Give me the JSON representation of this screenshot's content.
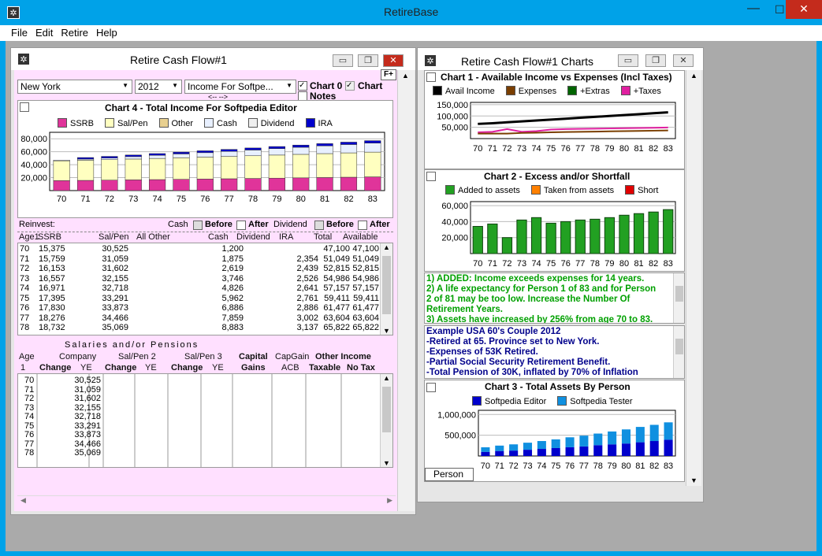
{
  "app": {
    "title": "RetireBase",
    "menu": [
      "File",
      "Edit",
      "Retire",
      "Help"
    ]
  },
  "cashflow": {
    "title": "Retire Cash Flow#1",
    "province": "New York",
    "year": "2012",
    "income_select": "Income For Softpe...",
    "chart0": "Chart 0",
    "chart": "Chart",
    "notes": "Notes",
    "arrows": "<--      -->",
    "fplus": "F+",
    "chart4": {
      "title": "Chart 4 - Total Income For Softpedia Editor",
      "legend": [
        {
          "name": "SSRB",
          "color": "#e0349a"
        },
        {
          "name": "Sal/Pen",
          "color": "#ffffc0"
        },
        {
          "name": "Other",
          "color": "#e8d090"
        },
        {
          "name": "Cash",
          "color": "#e8f0ff"
        },
        {
          "name": "Dividend",
          "color": "#f0f0f0"
        },
        {
          "name": "IRA",
          "color": "#0000cc"
        }
      ],
      "y_ticks": [
        "80,000",
        "60,000",
        "40,000",
        "20,000"
      ],
      "x": [
        "70",
        "71",
        "72",
        "73",
        "74",
        "75",
        "76",
        "77",
        "78",
        "79",
        "80",
        "81",
        "82",
        "83"
      ],
      "ssrb": [
        15375,
        15759,
        16153,
        16557,
        16971,
        17395,
        17830,
        18276,
        18732,
        19201,
        19681,
        20173,
        20677,
        21194
      ],
      "salpen": [
        30525,
        31059,
        31602,
        32155,
        32718,
        33291,
        33873,
        34466,
        35069,
        35683,
        36307,
        36943,
        37589,
        38247
      ],
      "cash": [
        1200,
        1875,
        2619,
        3746,
        4826,
        5962,
        6886,
        7859,
        8883,
        9900,
        10900,
        11900,
        12900,
        13900
      ],
      "ira": [
        0,
        2354,
        2439,
        2526,
        2641,
        2761,
        2886,
        3002,
        3137,
        3270,
        3400,
        3530,
        3660,
        3790
      ]
    },
    "reinvest": {
      "label": "Reinvest:",
      "cash": "Cash",
      "before": "Before",
      "after": "After",
      "dividend": "Dividend",
      "before2": "Before",
      "after2": "After"
    },
    "table_headers": [
      "Age1",
      "SSRB",
      "Sal/Pen",
      "All Other",
      "Cash",
      "Dividend",
      "IRA",
      "Total",
      "Available"
    ],
    "rows": [
      [
        "70",
        "15,375",
        "30,525",
        "",
        "1,200",
        "",
        "",
        "47,100",
        "47,100"
      ],
      [
        "71",
        "15,759",
        "31,059",
        "",
        "1,875",
        "",
        "2,354",
        "51,049",
        "51,049"
      ],
      [
        "72",
        "16,153",
        "31,602",
        "",
        "2,619",
        "",
        "2,439",
        "52,815",
        "52,815"
      ],
      [
        "73",
        "16,557",
        "32,155",
        "",
        "3,746",
        "",
        "2,526",
        "54,986",
        "54,986"
      ],
      [
        "74",
        "16,971",
        "32,718",
        "",
        "4,826",
        "",
        "2,641",
        "57,157",
        "57,157"
      ],
      [
        "75",
        "17,395",
        "33,291",
        "",
        "5,962",
        "",
        "2,761",
        "59,411",
        "59,411"
      ],
      [
        "76",
        "17,830",
        "33,873",
        "",
        "6,886",
        "",
        "2,886",
        "61,477",
        "61,477"
      ],
      [
        "77",
        "18,276",
        "34,466",
        "",
        "7,859",
        "",
        "3,002",
        "63,604",
        "63,604"
      ],
      [
        "78",
        "18,732",
        "35,069",
        "",
        "8,883",
        "",
        "3,137",
        "65,822",
        "65,822"
      ]
    ],
    "sal_title": "Salaries and/or Pensions",
    "sal_h1": [
      "Age",
      "Company",
      "Sal/Pen 2",
      "Sal/Pen 3",
      "Capital",
      "CapGain",
      "Other Income"
    ],
    "sal_h2": [
      "1",
      "Change",
      "YE",
      "Change",
      "YE",
      "Change",
      "YE",
      "Gains",
      "ACB",
      "Taxable",
      "No Tax"
    ],
    "sal_ages": [
      "70",
      "71",
      "72",
      "73",
      "74",
      "75",
      "76",
      "77",
      "78"
    ],
    "sal_ye": [
      "30,525",
      "31,059",
      "31,602",
      "32,155",
      "32,718",
      "33,291",
      "33,873",
      "34,466",
      "35,069"
    ]
  },
  "charts": {
    "title": "Retire Cash Flow#1 Charts",
    "chart1": {
      "title": "Chart 1 - Available Income vs Expenses (Incl Taxes)",
      "legend": [
        {
          "name": "Avail Income",
          "color": "#000000"
        },
        {
          "name": "Expenses",
          "color": "#7a3e00"
        },
        {
          "name": "+Extras",
          "color": "#006400"
        },
        {
          "name": "+Taxes",
          "color": "#e020a0"
        }
      ],
      "y_ticks": [
        "150,000",
        "100,000",
        "50,000"
      ],
      "x": [
        "70",
        "71",
        "72",
        "73",
        "74",
        "75",
        "76",
        "77",
        "78",
        "79",
        "80",
        "81",
        "82",
        "83"
      ],
      "avail": [
        65000,
        68000,
        72000,
        76000,
        80000,
        84000,
        88000,
        92000,
        96000,
        100000,
        104000,
        108000,
        112000,
        116000
      ],
      "expenses": [
        22000,
        22000,
        22000,
        25000,
        26000,
        28000,
        29000,
        30000,
        31000,
        32000,
        33000,
        34000,
        35000,
        36000
      ],
      "taxes": [
        28000,
        30000,
        42000,
        30000,
        33000,
        40000,
        42000,
        43000,
        44000,
        45000,
        46000,
        47000,
        48000,
        49000
      ]
    },
    "chart2": {
      "title": "Chart 2 - Excess and/or Shortfall",
      "legend": [
        {
          "name": "Added to assets",
          "color": "#22a022"
        },
        {
          "name": "Taken from assets",
          "color": "#ff8000"
        },
        {
          "name": "Short",
          "color": "#e00000"
        }
      ],
      "y_ticks": [
        "60,000",
        "40,000",
        "20,000"
      ],
      "x": [
        "70",
        "71",
        "72",
        "73",
        "74",
        "75",
        "76",
        "77",
        "78",
        "79",
        "80",
        "81",
        "82",
        "83"
      ],
      "values": [
        34000,
        37000,
        20000,
        42000,
        45000,
        38000,
        40000,
        42000,
        43000,
        45000,
        48000,
        50000,
        52000,
        55000
      ]
    },
    "notes_green": [
      "1) ADDED: Income exceeds expenses for 14 years.",
      "2) A life expectancy for Person 1 of 83 and for Person",
      "2 of 81 may be too low. Increase the Number Of",
      "Retirement Years.",
      "3) Assets have increased by 256% from age 70 to 83."
    ],
    "notes_blue": [
      "Example USA 60's Couple 2012",
      "-Retired at 65. Province set to New York.",
      "-Expenses of 53K Retired.",
      "-Partial Social Security Retirement Benefit.",
      "-Total Pension of 30K, inflated by 70% of Inflation"
    ],
    "chart3": {
      "title": "Chart 3 - Total Assets By Person",
      "legend": [
        {
          "name": "Softpedia Editor",
          "color": "#0000cc"
        },
        {
          "name": "Softpedia Tester",
          "color": "#1090e0"
        }
      ],
      "y_ticks": [
        "1,000,000",
        "500,000"
      ],
      "x": [
        "70",
        "71",
        "72",
        "73",
        "74",
        "75",
        "76",
        "77",
        "78",
        "79",
        "80",
        "81",
        "82",
        "83"
      ],
      "editor": [
        100000,
        120000,
        130000,
        150000,
        170000,
        190000,
        210000,
        230000,
        260000,
        280000,
        300000,
        330000,
        360000,
        390000
      ],
      "tester": [
        110000,
        130000,
        150000,
        170000,
        190000,
        210000,
        240000,
        260000,
        280000,
        310000,
        340000,
        370000,
        390000,
        420000
      ],
      "tab": "Person"
    }
  }
}
